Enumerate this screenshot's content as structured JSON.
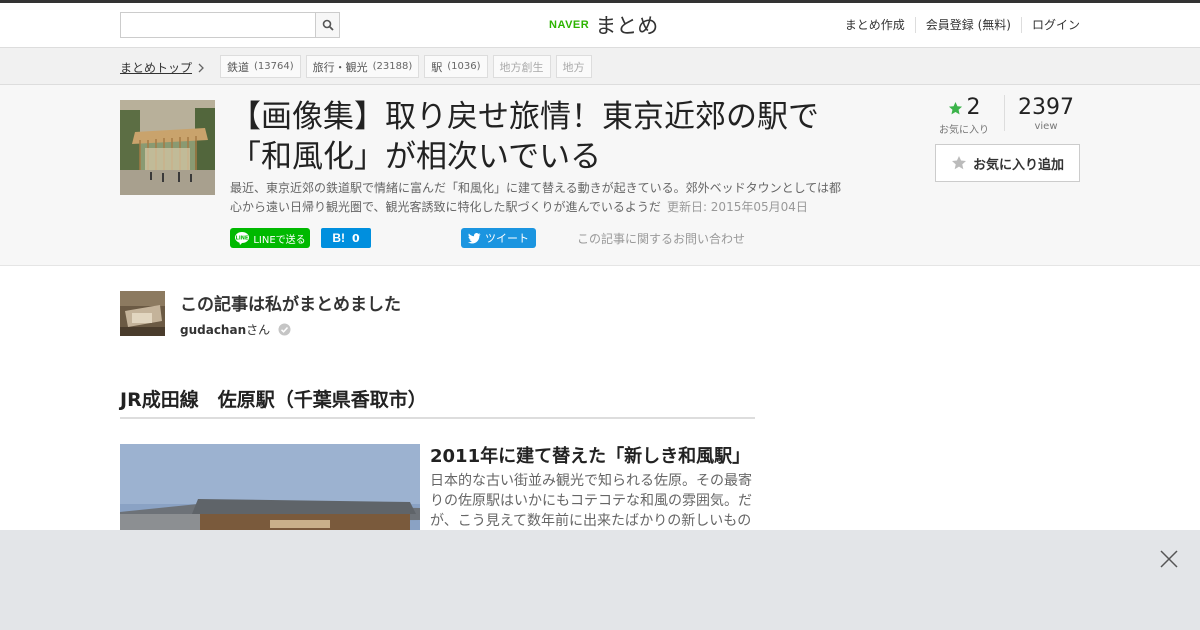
{
  "header": {
    "search_placeholder": "",
    "logo_naver": "NAVER",
    "logo_matome": "まとめ",
    "links": [
      "まとめ作成",
      "会員登録 (無料)",
      "ログイン"
    ]
  },
  "breadcrumb": {
    "top_label": "まとめトップ",
    "tags": [
      {
        "label": "鉄道",
        "count": "(13764)"
      },
      {
        "label": "旅行・観光",
        "count": "(23188)"
      },
      {
        "label": "駅",
        "count": "(1036)"
      },
      {
        "label": "地方創生",
        "count": ""
      },
      {
        "label": "地方",
        "count": ""
      }
    ]
  },
  "article": {
    "title": "【画像集】取り戻せ旅情！東京近郊の駅で「和風化」が相次いでいる",
    "description": "最近、東京近郊の鉄道駅で情緒に富んだ「和風化」に建て替える動きが起きている。郊外ベッドタウンとしては都心から遠い日帰り観光圏で、観光客誘致に特化した駅づくりが進んでいるようだ",
    "updated": "更新日: 2015年05月04日",
    "favorites_count": "2",
    "favorites_label": "お気に入り",
    "views_count": "2397",
    "views_label": "view",
    "fav_button": "お気に入り追加",
    "share": {
      "line": "LINEで送る",
      "hatena_count": "0",
      "tweet": "ツイート",
      "contact": "この記事に関するお問い合わせ"
    }
  },
  "author": {
    "heading": "この記事は私がまとめました",
    "name": "gudachan",
    "suffix": "さん"
  },
  "section": {
    "heading": "JR成田線　佐原駅（千葉県香取市）",
    "item_title": "2011年に建て替えた「新しき和風駅」",
    "item_text": "日本的な古い街並み観光で知られる佐原。その最寄りの佐原駅はいかにもコテコテな和風の雰囲気。だが、こう見えて数年前に出来たばかりの新しいもの"
  },
  "colors": {
    "line_green": "#00b900",
    "hatena_blue": "#008fde",
    "twitter_blue": "#1b95e0",
    "naver_green": "#2db400",
    "star_green": "#3bb34a"
  }
}
